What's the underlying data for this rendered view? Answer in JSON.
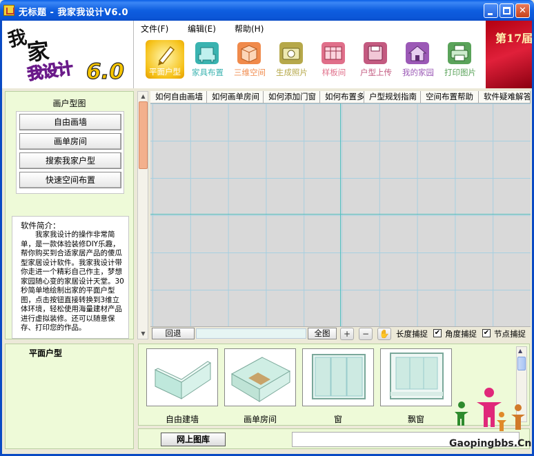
{
  "window": {
    "title": "无标题 - 我家我设计V6.0",
    "minimize": "minimize",
    "maximize": "maximize",
    "close": "✕"
  },
  "logo": {
    "line1": "我",
    "line2": "家",
    "line3": "我设计",
    "version": "6.0"
  },
  "menu": [
    {
      "label": "文件(F)"
    },
    {
      "label": "编辑(E)"
    },
    {
      "label": "帮助(H)"
    }
  ],
  "toolbar": [
    {
      "label": "平面户型",
      "icon": "pencil-icon",
      "color": "#f2b618",
      "active": true
    },
    {
      "label": "家具布置",
      "icon": "chair-icon",
      "color": "#3ab3b0"
    },
    {
      "label": "三维空间",
      "icon": "cube-icon",
      "color": "#f08a4b"
    },
    {
      "label": "生成照片",
      "icon": "camera-icon",
      "color": "#b6a84a"
    },
    {
      "label": "样板间",
      "icon": "showroom-icon",
      "color": "#e06f8a"
    },
    {
      "label": "户型上传",
      "icon": "floppy-icon",
      "color": "#c35a80"
    },
    {
      "label": "我的家园",
      "icon": "house-icon",
      "color": "#9b59b6"
    },
    {
      "label": "打印图片",
      "icon": "printer-icon",
      "color": "#5aa35a"
    }
  ],
  "banner": {
    "text": "第17届"
  },
  "left_panel": {
    "title": "画户型图",
    "buttons": [
      {
        "label": "自由画墙"
      },
      {
        "label": "画单房间"
      },
      {
        "label": "搜索我家户型"
      },
      {
        "label": "快速空间布置"
      }
    ],
    "intro_title": "软件简介：",
    "intro_text": "我家我设计的操作非常简单，是一款体验装修DIY乐趣，帮你购买到合适家居产品的傻瓜型家居设计软件。我家我设计带你走进一个精彩自己作主，梦想家园随心变的家居设计天堂。30秒简单地绘制出家的平面户型图，点击按钮直接转换到3维立体环境，轻松使用海量建材产品进行虚拟装修。还可以随意保存、打印您的作品。"
  },
  "tabs": [
    {
      "label": "如何自由画墙"
    },
    {
      "label": "如何画单房间"
    },
    {
      "label": "如何添加门窗"
    },
    {
      "label": "如何布置多个房间"
    },
    {
      "label": "户型规划指南"
    },
    {
      "label": "空间布置帮助"
    },
    {
      "label": "软件疑难解答"
    }
  ],
  "canvas_bar": {
    "undo": "回退",
    "fit": "全图",
    "zoom_in": "+",
    "zoom_out": "−",
    "pan": "✋",
    "checks": [
      {
        "label": "长度捕捉",
        "checked": true
      },
      {
        "label": "角度捕捉",
        "checked": true
      },
      {
        "label": "节点捕捉",
        "checked": true
      }
    ]
  },
  "bottom_left": {
    "title": "平面户型"
  },
  "gallery": [
    {
      "label": "自由建墙",
      "icon": "wall-icon"
    },
    {
      "label": "画单房间",
      "icon": "room-icon"
    },
    {
      "label": "窗",
      "icon": "window-icon"
    },
    {
      "label": "飘窗",
      "icon": "bay-window-icon"
    }
  ],
  "bottom_strip": {
    "button": "网上图库"
  },
  "watermark": {
    "text": "Gaopingbbs.Cn"
  }
}
